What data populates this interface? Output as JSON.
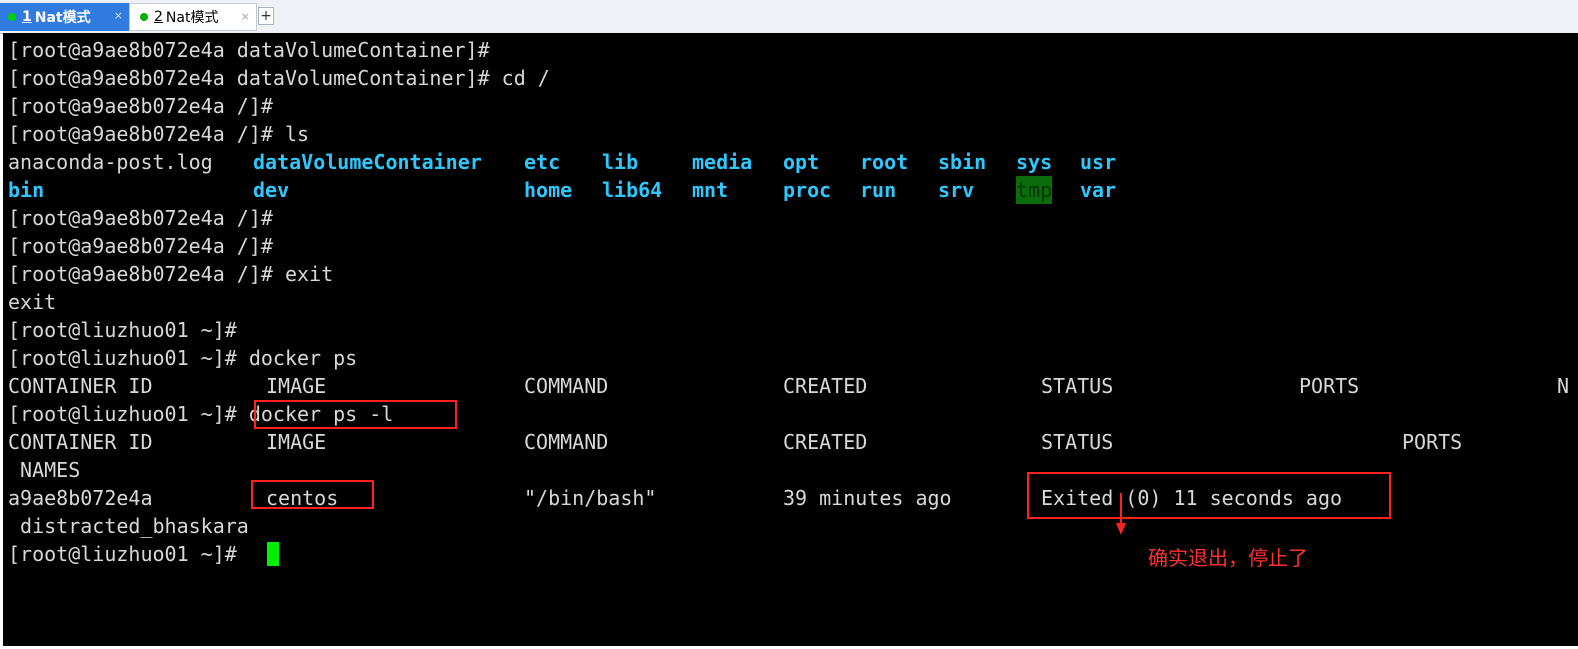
{
  "tabs": [
    {
      "number": "1",
      "label": "Nat模式"
    },
    {
      "number": "2",
      "label": "Nat模式"
    }
  ],
  "tab_close_glyph": "×",
  "new_tab_glyph": "+",
  "terminal": {
    "lines": [
      "[root@a9ae8b072e4a dataVolumeContainer]#",
      "[root@a9ae8b072e4a dataVolumeContainer]# cd /",
      "[root@a9ae8b072e4a /]#",
      "[root@a9ae8b072e4a /]# ls",
      "",
      "",
      "[root@a9ae8b072e4a /]#",
      "[root@a9ae8b072e4a /]#",
      "[root@a9ae8b072e4a /]# exit",
      "exit",
      "[root@liuzhuo01 ~]#",
      "[root@liuzhuo01 ~]# docker ps",
      "",
      "[root@liuzhuo01 ~]# docker ps -l",
      "",
      " NAMES",
      "",
      " distracted_bhaskara",
      "[root@liuzhuo01 ~]# "
    ],
    "ls_row1": [
      "anaconda-post.log",
      "dataVolumeContainer",
      "etc",
      "lib",
      "media",
      "opt",
      "root",
      "sbin",
      "sys",
      "usr"
    ],
    "ls_row2": [
      "bin",
      "dev",
      "home",
      "lib64",
      "mnt",
      "proc",
      "run",
      "srv",
      "tmp",
      "var"
    ],
    "ps_header": [
      "CONTAINER ID",
      "IMAGE",
      "COMMAND",
      "CREATED",
      "STATUS",
      "PORTS",
      "N"
    ],
    "psl_header": [
      "CONTAINER ID",
      "IMAGE",
      "COMMAND",
      "CREATED",
      "STATUS",
      "PORTS"
    ],
    "psl_row": [
      "a9ae8b072e4a",
      "centos",
      "\"/bin/bash\"",
      "39 minutes ago",
      "Exited (0) 11 seconds ago"
    ]
  },
  "annotation": "确实退出，停止了",
  "colors": {
    "terminal_bg": "#000000",
    "terminal_text": "#d8d8d8",
    "directory": "#2ec8ff",
    "cursor": "#00ee00",
    "highlight_box": "#ff2020",
    "active_tab": "#2f7be0"
  }
}
